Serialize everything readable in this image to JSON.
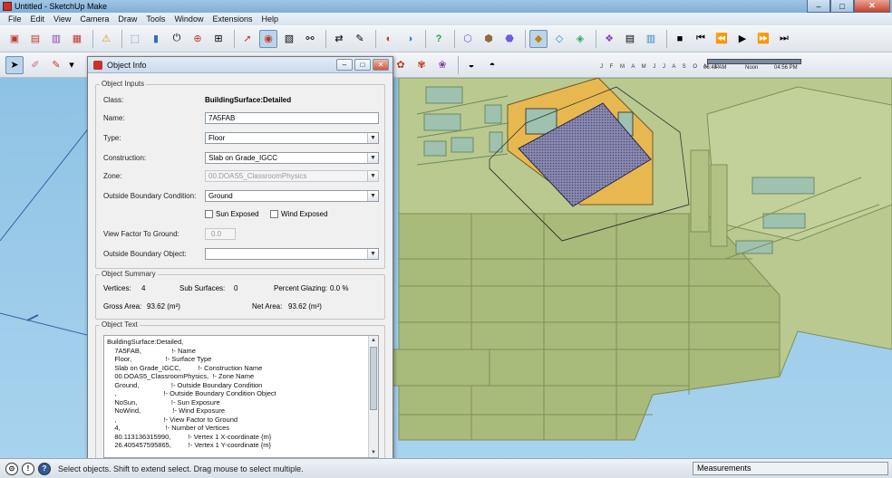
{
  "window": {
    "title": "Untitled - SketchUp Make",
    "minimize": "–",
    "maximize": "□",
    "close": "✕"
  },
  "menubar": [
    "File",
    "Edit",
    "View",
    "Camera",
    "Draw",
    "Tools",
    "Window",
    "Extensions",
    "Help"
  ],
  "shadow_widget": {
    "months": "J F M A M J J A S O N D",
    "time_start": "06:48 AM",
    "time_mid": "Noon",
    "time_end": "04:56 PM"
  },
  "object_info": {
    "title": "Object Info",
    "inputs_legend": "Object Inputs",
    "class_label": "Class:",
    "class_value": "BuildingSurface:Detailed",
    "name_label": "Name:",
    "name_value": "7A5FAB",
    "type_label": "Type:",
    "type_value": "Floor",
    "construction_label": "Construction:",
    "construction_value": "Slab on Grade_IGCC",
    "zone_label": "Zone:",
    "zone_value": "00.DOAS5_ClassroomPhysics",
    "obc_label": "Outside Boundary Condition:",
    "obc_value": "Ground",
    "sun_exposed_label": "Sun Exposed",
    "wind_exposed_label": "Wind Exposed",
    "view_factor_label": "View Factor To Ground:",
    "view_factor_value": "0.0",
    "obo_label": "Outside Boundary Object:",
    "obo_value": "",
    "summary_legend": "Object Summary",
    "vertices_label": "Vertices:",
    "vertices_value": "4",
    "subsurfaces_label": "Sub Surfaces:",
    "subsurfaces_value": "0",
    "glazing_label": "Percent Glazing:",
    "glazing_value": "0.0 %",
    "gross_label": "Gross Area:",
    "gross_value": "93.62 (m²)",
    "net_label": "Net Area:",
    "net_value": "93.62 (m²)",
    "text_legend": "Object Text",
    "object_text": "BuildingSurface:Detailed,\n    7A5FAB,                !- Name\n    Floor,                  !- Surface Type\n    Slab on Grade_IGCC,         !- Construction Name\n    00.DOAS5_ClassroomPhysics,  !- Zone Name\n    Ground,                 !- Outside Boundary Condition\n    ,                         !- Outside Boundary Condition Object\n    NoSun,                  !- Sun Exposure\n    NoWind,                 !- Wind Exposure\n    ,                         !- View Factor to Ground\n    4,                        !- Number of Vertices\n    80.113136315990,         !- Vertex 1 X-coordinate {m}\n    26.405457595865,         !- Vertex 1 Y-coordinate {m}"
  },
  "statusbar": {
    "hint": "Select objects. Shift to extend select. Drag mouse to select multiple.",
    "measurements": "Measurements"
  },
  "colors": {
    "building": "#b9c98f",
    "building_dark": "#98aa6c",
    "highlight": "#e8b850",
    "floor_hatch": "#6a6a9a",
    "sky": "#8ec2e4"
  }
}
